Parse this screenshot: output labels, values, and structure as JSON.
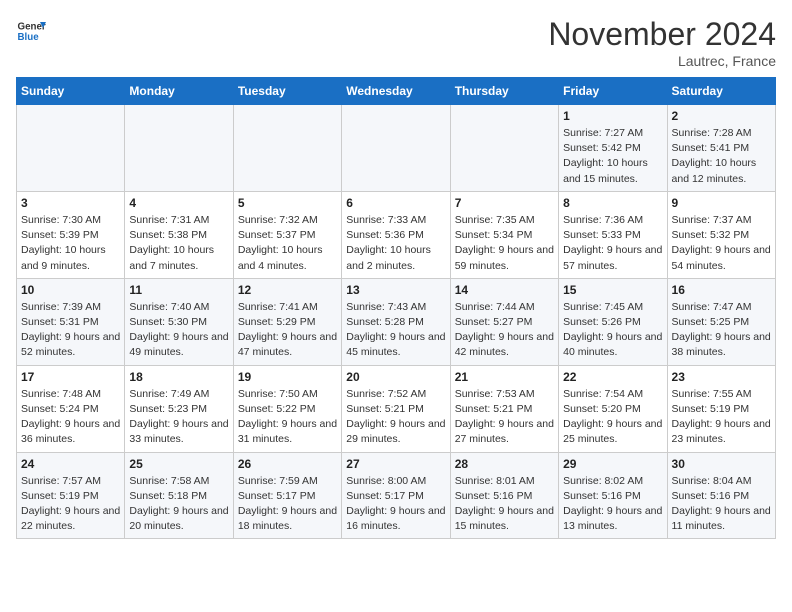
{
  "header": {
    "logo_line1": "General",
    "logo_line2": "Blue",
    "month": "November 2024",
    "location": "Lautrec, France"
  },
  "weekdays": [
    "Sunday",
    "Monday",
    "Tuesday",
    "Wednesday",
    "Thursday",
    "Friday",
    "Saturday"
  ],
  "weeks": [
    [
      {
        "day": "",
        "info": ""
      },
      {
        "day": "",
        "info": ""
      },
      {
        "day": "",
        "info": ""
      },
      {
        "day": "",
        "info": ""
      },
      {
        "day": "",
        "info": ""
      },
      {
        "day": "1",
        "info": "Sunrise: 7:27 AM\nSunset: 5:42 PM\nDaylight: 10 hours and 15 minutes."
      },
      {
        "day": "2",
        "info": "Sunrise: 7:28 AM\nSunset: 5:41 PM\nDaylight: 10 hours and 12 minutes."
      }
    ],
    [
      {
        "day": "3",
        "info": "Sunrise: 7:30 AM\nSunset: 5:39 PM\nDaylight: 10 hours and 9 minutes."
      },
      {
        "day": "4",
        "info": "Sunrise: 7:31 AM\nSunset: 5:38 PM\nDaylight: 10 hours and 7 minutes."
      },
      {
        "day": "5",
        "info": "Sunrise: 7:32 AM\nSunset: 5:37 PM\nDaylight: 10 hours and 4 minutes."
      },
      {
        "day": "6",
        "info": "Sunrise: 7:33 AM\nSunset: 5:36 PM\nDaylight: 10 hours and 2 minutes."
      },
      {
        "day": "7",
        "info": "Sunrise: 7:35 AM\nSunset: 5:34 PM\nDaylight: 9 hours and 59 minutes."
      },
      {
        "day": "8",
        "info": "Sunrise: 7:36 AM\nSunset: 5:33 PM\nDaylight: 9 hours and 57 minutes."
      },
      {
        "day": "9",
        "info": "Sunrise: 7:37 AM\nSunset: 5:32 PM\nDaylight: 9 hours and 54 minutes."
      }
    ],
    [
      {
        "day": "10",
        "info": "Sunrise: 7:39 AM\nSunset: 5:31 PM\nDaylight: 9 hours and 52 minutes."
      },
      {
        "day": "11",
        "info": "Sunrise: 7:40 AM\nSunset: 5:30 PM\nDaylight: 9 hours and 49 minutes."
      },
      {
        "day": "12",
        "info": "Sunrise: 7:41 AM\nSunset: 5:29 PM\nDaylight: 9 hours and 47 minutes."
      },
      {
        "day": "13",
        "info": "Sunrise: 7:43 AM\nSunset: 5:28 PM\nDaylight: 9 hours and 45 minutes."
      },
      {
        "day": "14",
        "info": "Sunrise: 7:44 AM\nSunset: 5:27 PM\nDaylight: 9 hours and 42 minutes."
      },
      {
        "day": "15",
        "info": "Sunrise: 7:45 AM\nSunset: 5:26 PM\nDaylight: 9 hours and 40 minutes."
      },
      {
        "day": "16",
        "info": "Sunrise: 7:47 AM\nSunset: 5:25 PM\nDaylight: 9 hours and 38 minutes."
      }
    ],
    [
      {
        "day": "17",
        "info": "Sunrise: 7:48 AM\nSunset: 5:24 PM\nDaylight: 9 hours and 36 minutes."
      },
      {
        "day": "18",
        "info": "Sunrise: 7:49 AM\nSunset: 5:23 PM\nDaylight: 9 hours and 33 minutes."
      },
      {
        "day": "19",
        "info": "Sunrise: 7:50 AM\nSunset: 5:22 PM\nDaylight: 9 hours and 31 minutes."
      },
      {
        "day": "20",
        "info": "Sunrise: 7:52 AM\nSunset: 5:21 PM\nDaylight: 9 hours and 29 minutes."
      },
      {
        "day": "21",
        "info": "Sunrise: 7:53 AM\nSunset: 5:21 PM\nDaylight: 9 hours and 27 minutes."
      },
      {
        "day": "22",
        "info": "Sunrise: 7:54 AM\nSunset: 5:20 PM\nDaylight: 9 hours and 25 minutes."
      },
      {
        "day": "23",
        "info": "Sunrise: 7:55 AM\nSunset: 5:19 PM\nDaylight: 9 hours and 23 minutes."
      }
    ],
    [
      {
        "day": "24",
        "info": "Sunrise: 7:57 AM\nSunset: 5:19 PM\nDaylight: 9 hours and 22 minutes."
      },
      {
        "day": "25",
        "info": "Sunrise: 7:58 AM\nSunset: 5:18 PM\nDaylight: 9 hours and 20 minutes."
      },
      {
        "day": "26",
        "info": "Sunrise: 7:59 AM\nSunset: 5:17 PM\nDaylight: 9 hours and 18 minutes."
      },
      {
        "day": "27",
        "info": "Sunrise: 8:00 AM\nSunset: 5:17 PM\nDaylight: 9 hours and 16 minutes."
      },
      {
        "day": "28",
        "info": "Sunrise: 8:01 AM\nSunset: 5:16 PM\nDaylight: 9 hours and 15 minutes."
      },
      {
        "day": "29",
        "info": "Sunrise: 8:02 AM\nSunset: 5:16 PM\nDaylight: 9 hours and 13 minutes."
      },
      {
        "day": "30",
        "info": "Sunrise: 8:04 AM\nSunset: 5:16 PM\nDaylight: 9 hours and 11 minutes."
      }
    ]
  ]
}
